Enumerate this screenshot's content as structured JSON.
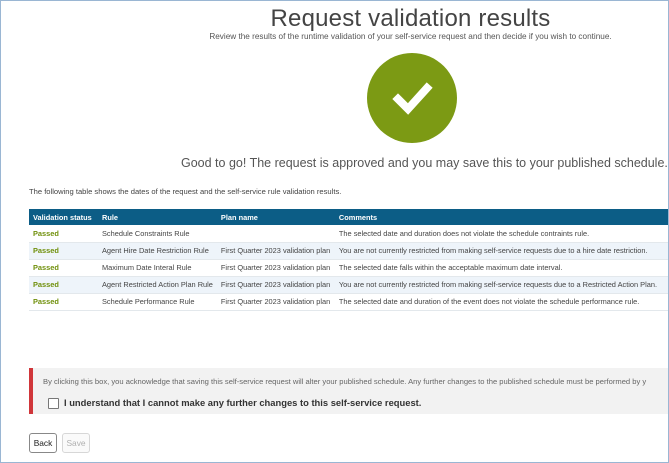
{
  "page": {
    "title": "Request validation results",
    "subtitle": "Review the results of the runtime validation of your self-service request and then decide if you wish to continue.",
    "status_icon": "checkmark-icon",
    "status_color": "#7c9a14",
    "approval_message": "Good to go! The request is approved and you may save this to your published schedule. [51]"
  },
  "table": {
    "intro": "The following table shows the dates of the request and the self-service rule validation results.",
    "header_color": "#0c5d86",
    "columns": [
      "Validation status",
      "Rule",
      "Plan name",
      "Comments"
    ],
    "rows": [
      {
        "status": "Passed",
        "rule": "Schedule Constraints Rule",
        "plan": "",
        "comment": "The selected date and duration does not violate the schedule contraints rule."
      },
      {
        "status": "Passed",
        "rule": "Agent Hire Date Restriction Rule",
        "plan": "First Quarter 2023 validation plan",
        "comment": "You are not currently restricted from making self-service requests due to a hire date restriction."
      },
      {
        "status": "Passed",
        "rule": "Maximum Date Interal Rule",
        "plan": "First Quarter 2023 validation plan",
        "comment": "The selected date falls within the acceptable maximum date interval."
      },
      {
        "status": "Passed",
        "rule": "Agent Restricted Action Plan Rule",
        "plan": "First Quarter 2023 validation plan",
        "comment": "You are not currently restricted from making self-service requests due to a Restricted Action Plan."
      },
      {
        "status": "Passed",
        "rule": "Schedule Performance Rule",
        "plan": "First Quarter 2023 validation plan",
        "comment": "The selected date and duration of the event does not violate the schedule performance rule."
      }
    ]
  },
  "acknowledgement": {
    "notice": "By clicking this box, you acknowledge that saving this self-service request will alter your published schedule. Any further changes to the published schedule must be performed by y",
    "checkbox_label": "I understand that I cannot make any further changes to this self-service request.",
    "checked": false,
    "accent_color": "#d0363a"
  },
  "buttons": {
    "back": "Back",
    "save": "Save"
  }
}
